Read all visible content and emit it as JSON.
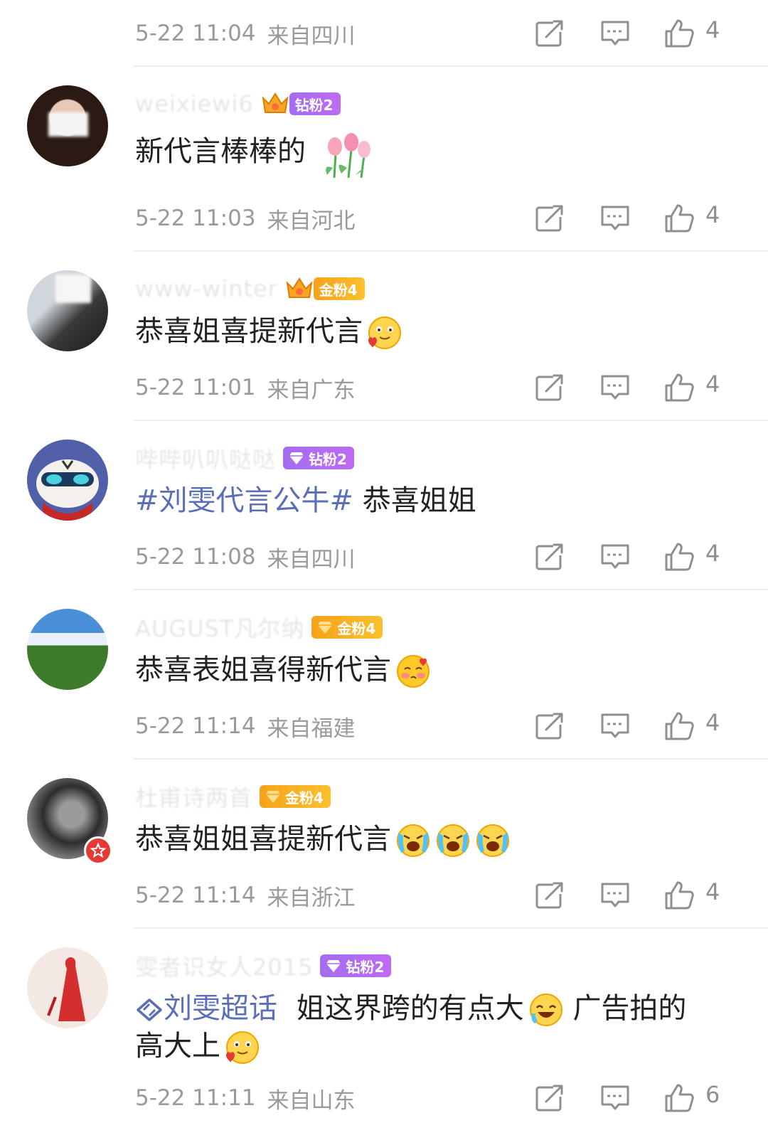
{
  "comments": [
    {
      "text": "",
      "time": "5-22 11:04",
      "location": "来自四川",
      "likes": "4"
    },
    {
      "username": "weixiewi6",
      "badge": "钻粉2",
      "text": "新代言棒棒的",
      "time": "5-22 11:03",
      "location": "来自河北",
      "likes": "4"
    },
    {
      "username": "www-winter",
      "badge": "金粉4",
      "text": "恭喜姐喜提新代言",
      "time": "5-22 11:01",
      "location": "来自广东",
      "likes": "4"
    },
    {
      "username": "哔哔叭叭哒哒",
      "badge": "钻粉2",
      "hashtag": "#刘雯代言公牛#",
      "text": "恭喜姐姐",
      "time": "5-22 11:08",
      "location": "来自四川",
      "likes": "4"
    },
    {
      "username": "AUGUST凡尔纳",
      "badge": "金粉4",
      "text": "恭喜表姐喜得新代言",
      "time": "5-22 11:14",
      "location": "来自福建",
      "likes": "4"
    },
    {
      "username": "杜甫诗两首",
      "badge": "金粉4",
      "text": "恭喜姐姐喜提新代言",
      "time": "5-22 11:14",
      "location": "来自浙江",
      "likes": "4"
    },
    {
      "username": "雯者识女人2015",
      "badge": "钻粉2",
      "supertopic": "刘雯超话",
      "text_part1": "姐这界跨的有点大",
      "text_part2": "广告拍的",
      "text_part3": "高大上",
      "time": "5-22 11:11",
      "location": "来自山东",
      "likes": "6"
    }
  ],
  "colors": {
    "link": "#5a6fb8",
    "meta": "#9a9a9a",
    "purple_badge": "#b06cf3",
    "gold_badge": "#f7a21a"
  },
  "icons": [
    "share-icon",
    "comment-icon",
    "like-icon",
    "crown-icon",
    "diamond-icon",
    "supertopic-icon"
  ]
}
